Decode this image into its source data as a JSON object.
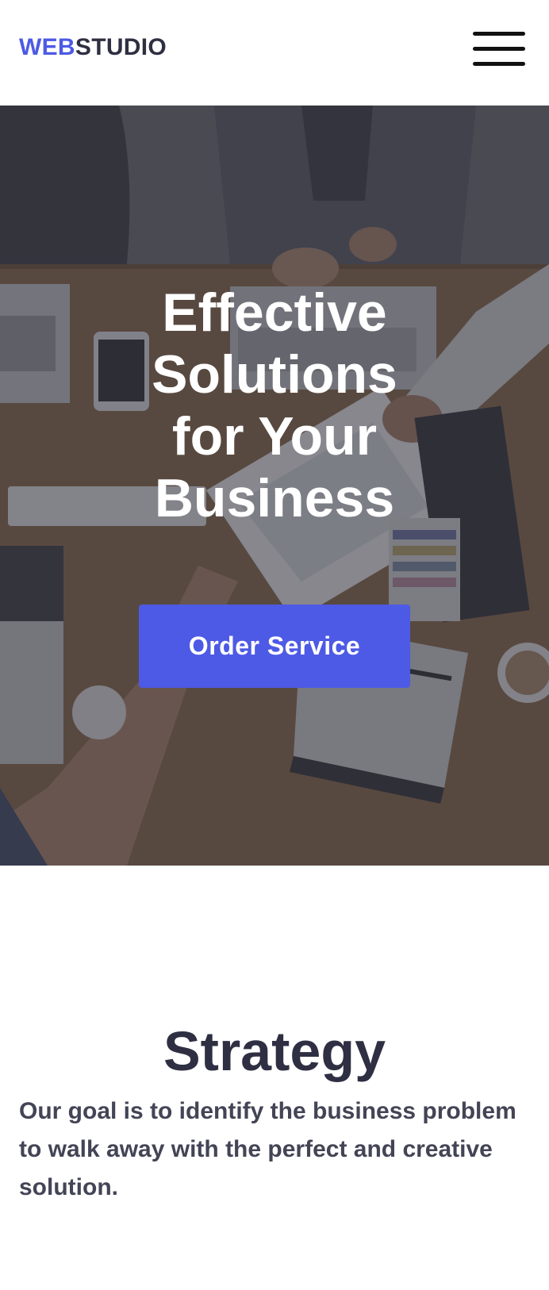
{
  "header": {
    "logo_accent": "WEB",
    "logo_rest": "STUDIO",
    "menu_icon": "hamburger-menu-icon"
  },
  "hero": {
    "title": "Effective Solutions for Your Business",
    "cta_label": "Order Service",
    "background_description_icon": "meeting-photo"
  },
  "strategy": {
    "title": "Strategy",
    "text": "Our goal is to identify the business problem to walk away with the perfect and creative solution."
  },
  "colors": {
    "accent": "#4d5ae5",
    "dark": "#2e2f42",
    "overlay": "#2f303a"
  }
}
